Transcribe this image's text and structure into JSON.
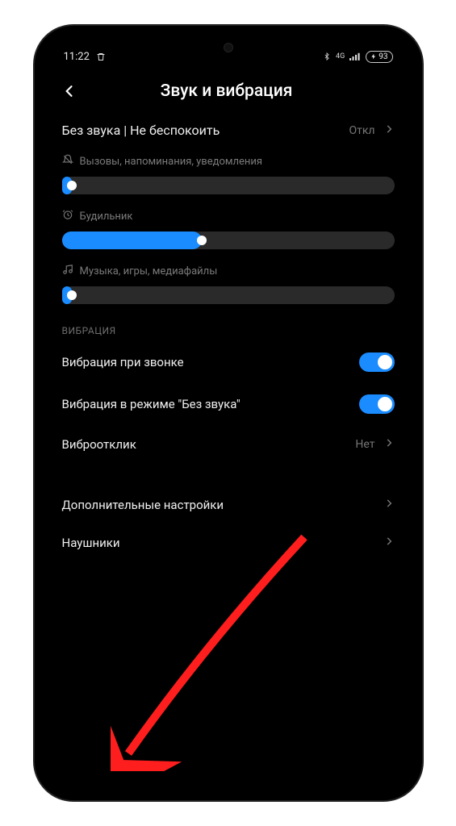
{
  "status": {
    "time": "11:22",
    "network_label": "4G",
    "battery_pct": "93"
  },
  "header": {
    "title": "Звук и вибрация"
  },
  "dnd": {
    "label": "Без звука | Не беспокоить",
    "value": "Откл"
  },
  "sliders": {
    "ring": {
      "label": "Вызовы, напоминания, уведомления",
      "percent": 3
    },
    "alarm": {
      "label": "Будильник",
      "percent": 42
    },
    "media": {
      "label": "Музыка, игры, медиафайлы",
      "percent": 3
    }
  },
  "vibration": {
    "section_title": "ВИБРАЦИЯ",
    "on_call": {
      "label": "Вибрация при звонке",
      "on": true
    },
    "silent": {
      "label": "Вибрация в режиме \"Без звука\"",
      "on": true
    },
    "feedback": {
      "label": "Виброотклик",
      "value": "Нет"
    }
  },
  "more": {
    "advanced": "Дополнительные настройки",
    "headphones": "Наушники"
  },
  "colors": {
    "accent": "#1a8cff",
    "arrow": "#ff1e1e"
  }
}
